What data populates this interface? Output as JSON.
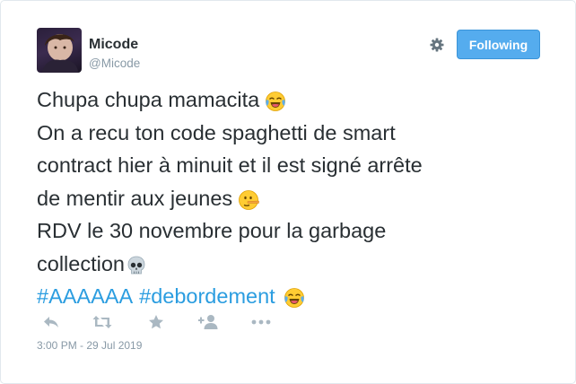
{
  "author": {
    "name": "Micode",
    "handle": "@Micode"
  },
  "follow_button": {
    "label": "Following"
  },
  "tweet": {
    "lines": [
      "Chupa chupa mamacita",
      "On a recu ton code spaghetti de smart",
      "contract hier à minuit et il est signé arrête",
      "de mentir aux jeunes",
      "RDV le 30 novembre pour la garbage",
      "collection"
    ],
    "hashtags": [
      "#AAAAAA",
      "#debordement"
    ]
  },
  "icons": {
    "settings": "gear-icon",
    "reply": "reply-icon",
    "retweet": "retweet-icon",
    "favorite": "star-icon",
    "follow": "add-user-icon",
    "more": "more-icon",
    "emoji_laugh": "tears-of-joy-emoji",
    "emoji_lying": "lying-face-emoji",
    "emoji_skull": "skull-emoji"
  },
  "timestamp": "3:00 PM - 29 Jul 2019",
  "colors": {
    "accent": "#55acee",
    "hashtag": "#2b9de0",
    "muted": "#8899a6",
    "text": "#292f33"
  }
}
